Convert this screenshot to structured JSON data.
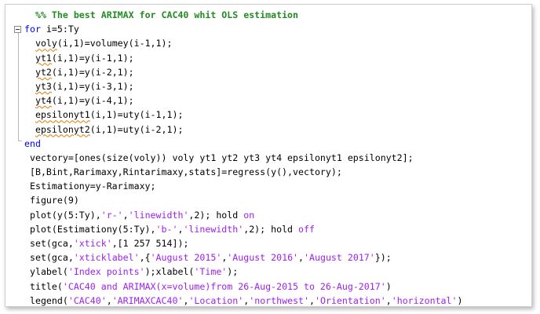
{
  "editor": {
    "lines": [
      [
        {
          "t": "  ",
          "c": "plain"
        },
        {
          "t": "%% The best ARIMAX for CAC40 whit OLS estimation",
          "c": "comment"
        }
      ],
      [
        {
          "t": "for",
          "c": "kw"
        },
        {
          "t": " i=5:Ty",
          "c": "plain"
        }
      ],
      [
        {
          "t": "  ",
          "c": "plain"
        },
        {
          "t": "voly",
          "c": "wavy"
        },
        {
          "t": "(i,1)=volumey(i-1,1);",
          "c": "plain"
        }
      ],
      [
        {
          "t": "  ",
          "c": "plain"
        },
        {
          "t": "yt1",
          "c": "wavy"
        },
        {
          "t": "(i,1)=y(i-1,1);",
          "c": "plain"
        }
      ],
      [
        {
          "t": "  ",
          "c": "plain"
        },
        {
          "t": "yt2",
          "c": "wavy"
        },
        {
          "t": "(i,1)=y(i-2,1);",
          "c": "plain"
        }
      ],
      [
        {
          "t": "  ",
          "c": "plain"
        },
        {
          "t": "yt3",
          "c": "wavy"
        },
        {
          "t": "(i,1)=y(i-3,1);",
          "c": "plain"
        }
      ],
      [
        {
          "t": "  ",
          "c": "plain"
        },
        {
          "t": "yt4",
          "c": "wavy"
        },
        {
          "t": "(i,1)=y(i-4,1);",
          "c": "plain"
        }
      ],
      [
        {
          "t": "  ",
          "c": "plain"
        },
        {
          "t": "epsilonyt1",
          "c": "wavy"
        },
        {
          "t": "(i,1)=uty(i-1,1);",
          "c": "plain"
        }
      ],
      [
        {
          "t": "  ",
          "c": "plain"
        },
        {
          "t": "epsilonyt2",
          "c": "wavy"
        },
        {
          "t": "(i,1)=uty(i-2,1);",
          "c": "plain"
        }
      ],
      [
        {
          "t": "end",
          "c": "kw"
        }
      ],
      [
        {
          "t": " vectory=[ones(size(voly)) voly yt1 yt2 yt3 yt4 epsilonyt1 epsilonyt2];",
          "c": "plain"
        }
      ],
      [
        {
          "t": " [B,Bint,Rarimaxy,Rintarimaxy,stats]=regress(y(),vectory);",
          "c": "plain"
        }
      ],
      [
        {
          "t": " Estimationy=y-Rarimaxy;",
          "c": "plain"
        }
      ],
      [
        {
          "t": " figure(9)",
          "c": "plain"
        }
      ],
      [
        {
          "t": " plot(y(5:Ty),",
          "c": "plain"
        },
        {
          "t": "'r-'",
          "c": "str"
        },
        {
          "t": ",",
          "c": "plain"
        },
        {
          "t": "'linewidth'",
          "c": "str"
        },
        {
          "t": ",2); hold ",
          "c": "plain"
        },
        {
          "t": "on",
          "c": "str"
        }
      ],
      [
        {
          "t": " plot(Estimationy(5:Ty),",
          "c": "plain"
        },
        {
          "t": "'b-'",
          "c": "str"
        },
        {
          "t": ",",
          "c": "plain"
        },
        {
          "t": "'linewidth'",
          "c": "str"
        },
        {
          "t": ",2); hold ",
          "c": "plain"
        },
        {
          "t": "off",
          "c": "str"
        }
      ],
      [
        {
          "t": " set(gca,",
          "c": "plain"
        },
        {
          "t": "'xtick'",
          "c": "str"
        },
        {
          "t": ",[1 257 514]);",
          "c": "plain"
        }
      ],
      [
        {
          "t": " set(gca,",
          "c": "plain"
        },
        {
          "t": "'xticklabel'",
          "c": "str"
        },
        {
          "t": ",{",
          "c": "plain"
        },
        {
          "t": "'August 2015'",
          "c": "str"
        },
        {
          "t": ",",
          "c": "plain"
        },
        {
          "t": "'August 2016'",
          "c": "str"
        },
        {
          "t": ",",
          "c": "plain"
        },
        {
          "t": "'August 2017'",
          "c": "str"
        },
        {
          "t": "});",
          "c": "plain"
        }
      ],
      [
        {
          "t": " ylabel(",
          "c": "plain"
        },
        {
          "t": "'Index points'",
          "c": "str"
        },
        {
          "t": ");xlabel(",
          "c": "plain"
        },
        {
          "t": "'Time'",
          "c": "str"
        },
        {
          "t": ");",
          "c": "plain"
        }
      ],
      [
        {
          "t": " title(",
          "c": "plain"
        },
        {
          "t": "'CAC40 and ARIMAX(x=volume)from 26-Aug-2015 to 26-Aug-2017'",
          "c": "str"
        },
        {
          "t": ")",
          "c": "plain"
        }
      ],
      [
        {
          "t": " legend(",
          "c": "plain"
        },
        {
          "t": "'CAC40'",
          "c": "str"
        },
        {
          "t": ",",
          "c": "plain"
        },
        {
          "t": "'ARIMAXCAC40'",
          "c": "str"
        },
        {
          "t": ",",
          "c": "plain"
        },
        {
          "t": "'Location'",
          "c": "str"
        },
        {
          "t": ",",
          "c": "plain"
        },
        {
          "t": "'northwest'",
          "c": "str"
        },
        {
          "t": ",",
          "c": "plain"
        },
        {
          "t": "'Orientation'",
          "c": "str"
        },
        {
          "t": ",",
          "c": "plain"
        },
        {
          "t": "'horizontal'",
          "c": "str"
        },
        {
          "t": ")",
          "c": "plain"
        }
      ]
    ]
  },
  "colors": {
    "comment": "#228b22",
    "keyword": "#0000ff",
    "string": "#a020f0",
    "plain": "#000000",
    "warning_underline": "#e07b00"
  },
  "icons": {
    "fold_toggle": "code-fold-collapse-icon"
  }
}
